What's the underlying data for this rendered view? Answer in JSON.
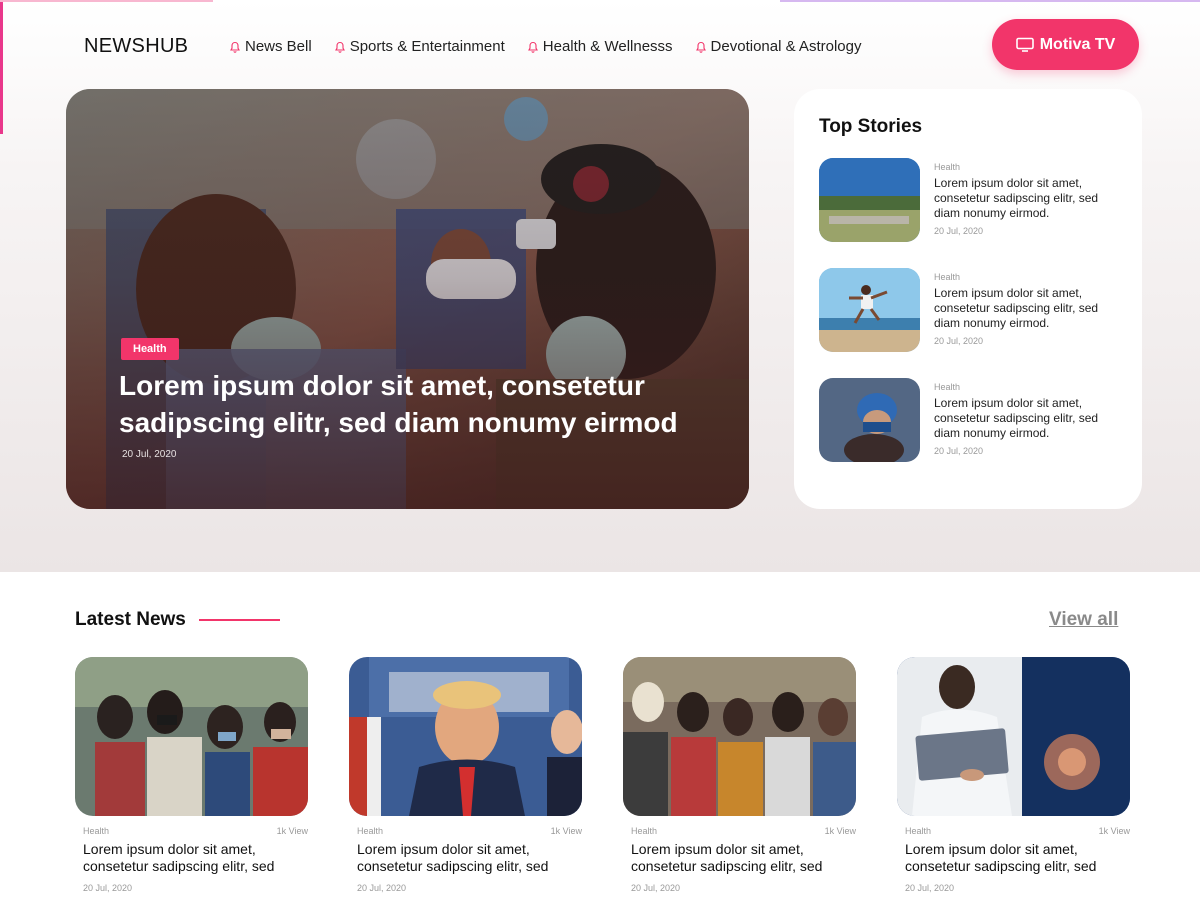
{
  "header": {
    "logo": "NEWSHUB",
    "nav": [
      {
        "label": "News Bell"
      },
      {
        "label": "Sports & Entertainment"
      },
      {
        "label": "Health & Wellnesss"
      },
      {
        "label": "Devotional & Astrology"
      }
    ],
    "tv_button": "Motiva TV"
  },
  "featured": {
    "category": "Health",
    "title": "Lorem ipsum dolor sit amet, consetetur sadipscing elitr, sed diam nonumy eirmod",
    "date": "20 Jul, 2020"
  },
  "top_stories": {
    "title": "Top Stories",
    "items": [
      {
        "category": "Health",
        "text": "Lorem ipsum dolor sit amet, consetetur sadipscing elitr, sed diam nonumy eirmod.",
        "date": "20 Jul, 2020"
      },
      {
        "category": "Health",
        "text": "Lorem ipsum dolor sit amet, consetetur sadipscing elitr, sed diam nonumy eirmod.",
        "date": "20 Jul, 2020"
      },
      {
        "category": "Health",
        "text": "Lorem ipsum dolor sit amet, consetetur sadipscing elitr, sed diam nonumy eirmod.",
        "date": "20 Jul, 2020"
      }
    ]
  },
  "latest": {
    "title": "Latest News",
    "view_all": "View all",
    "cards": [
      {
        "category": "Health",
        "views": "1k View",
        "text": "Lorem ipsum dolor sit amet, consetetur sadipscing elitr, sed",
        "date": "20 Jul, 2020"
      },
      {
        "category": "Health",
        "views": "1k View",
        "text": "Lorem ipsum dolor sit amet, consetetur sadipscing elitr, sed",
        "date": "20 Jul, 2020"
      },
      {
        "category": "Health",
        "views": "1k View",
        "text": "Lorem ipsum dolor sit amet, consetetur sadipscing elitr, sed",
        "date": "20 Jul, 2020"
      },
      {
        "category": "Health",
        "views": "1k View",
        "text": "Lorem ipsum dolor sit amet, consetetur sadipscing elitr, sed",
        "date": "20 Jul, 2020"
      }
    ]
  },
  "colors": {
    "accent": "#f2356a",
    "muted": "#999999"
  },
  "icons": {
    "nav": "bell-icon",
    "tv": "tv-icon"
  }
}
